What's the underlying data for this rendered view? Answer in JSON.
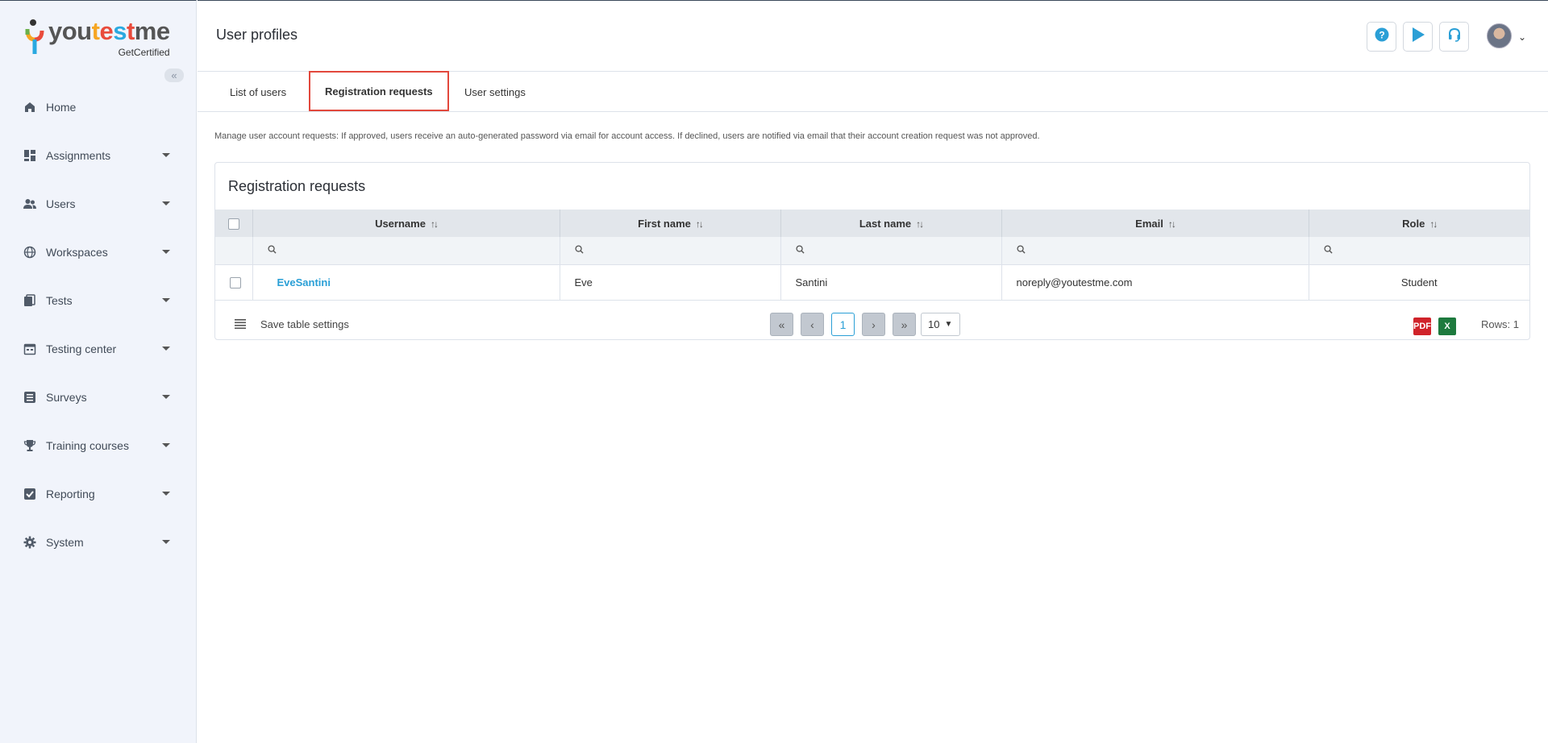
{
  "logo": {
    "part1": "you",
    "part2": "t",
    "part3": "e",
    "part4": "s",
    "part5": "t",
    "part6": "me",
    "subtitle": "GetCertified"
  },
  "sidebar": {
    "collapse_icon": "double-chevron-left-icon",
    "items": [
      {
        "label": "Home",
        "icon": "home-icon",
        "expandable": false
      },
      {
        "label": "Assignments",
        "icon": "dashboard-icon",
        "expandable": true
      },
      {
        "label": "Users",
        "icon": "users-icon",
        "expandable": true
      },
      {
        "label": "Workspaces",
        "icon": "globe-icon",
        "expandable": true
      },
      {
        "label": "Tests",
        "icon": "copy-icon",
        "expandable": true
      },
      {
        "label": "Testing center",
        "icon": "calendar-icon",
        "expandable": true
      },
      {
        "label": "Surveys",
        "icon": "list-icon",
        "expandable": true
      },
      {
        "label": "Training courses",
        "icon": "trophy-icon",
        "expandable": true
      },
      {
        "label": "Reporting",
        "icon": "check-square-icon",
        "expandable": true
      },
      {
        "label": "System",
        "icon": "gear-icon",
        "expandable": true
      }
    ]
  },
  "header": {
    "title": "User profiles",
    "help_icon": "question-icon",
    "play_icon": "play-icon",
    "support_icon": "headset-icon"
  },
  "tabs": {
    "list_of_users": "List of users",
    "registration_requests": "Registration requests",
    "user_settings": "User settings",
    "active": "Registration requests"
  },
  "description": "Manage user account requests: If approved, users receive an auto-generated password via email for account access. If declined, users are notified via email that their account creation request was not approved.",
  "card": {
    "title": "Registration requests"
  },
  "table": {
    "columns": [
      "Username",
      "First name",
      "Last name",
      "Email",
      "Role"
    ],
    "rows": [
      {
        "username": "EveSantini",
        "first_name": "Eve",
        "last_name": "Santini",
        "email": "noreply@youtestme.com",
        "role": "Student"
      }
    ]
  },
  "footer": {
    "save_settings": "Save table settings",
    "current_page": "1",
    "rows_per_page": "10",
    "rows_count": "Rows: 1"
  },
  "colors": {
    "accent": "#2a9fd6",
    "active_tab_border": "#e2483c",
    "sidebar_bg": "#f1f4fb"
  }
}
